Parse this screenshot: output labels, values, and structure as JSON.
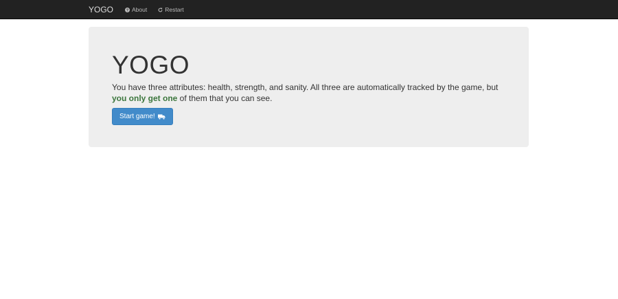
{
  "navbar": {
    "brand": "YOGO",
    "links": [
      {
        "label": "About",
        "icon": "question-circle-icon"
      },
      {
        "label": "Restart",
        "icon": "refresh-icon"
      }
    ]
  },
  "hero": {
    "title": "YOGO",
    "desc_before": "You have three attributes: health, strength, and sanity. All three are automatically tracked by the game, but ",
    "desc_highlight": "you only get one",
    "desc_after": " of them that you can see.",
    "start_label": "Start game!",
    "start_icon": "truck-icon"
  },
  "colors": {
    "navbar_bg": "#222222",
    "jumbotron_bg": "#eeeeee",
    "primary": "#428bca",
    "highlight_text": "#3c763d"
  }
}
